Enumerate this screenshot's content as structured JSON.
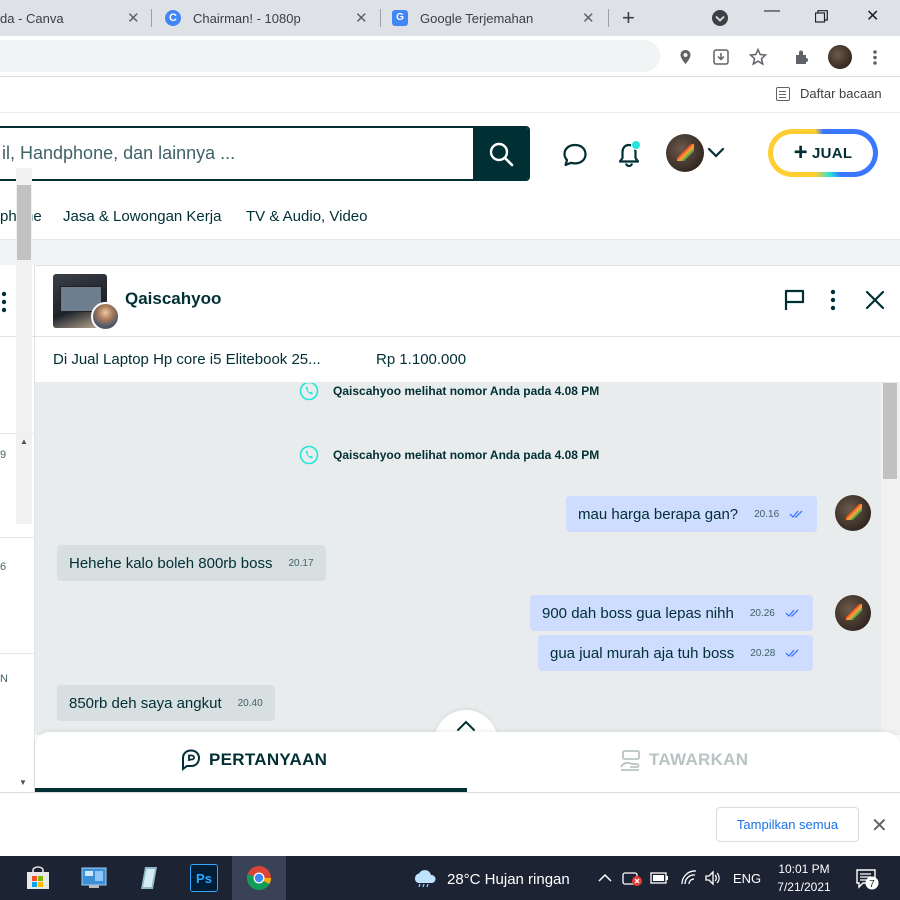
{
  "browser": {
    "tabs": [
      {
        "title": "da - Canva",
        "favicon": "canva-favicon"
      },
      {
        "title": "Chairman! - 1080p",
        "favicon": "chairman-favicon"
      },
      {
        "title": "Google Terjemahan",
        "favicon": "google-translate-favicon"
      }
    ],
    "reading_list": "Daftar bacaan"
  },
  "header": {
    "search_placeholder": "il, Handphone, dan lainnya ...",
    "sell_label": "JUAL",
    "accent_color": "#23e5db",
    "brand_color": "#002f34"
  },
  "categories": [
    "phone",
    "Jasa & Lowongan Kerja",
    "TV & Audio, Video"
  ],
  "left_list": {
    "numbers": [
      "9",
      "6",
      "N"
    ]
  },
  "chat": {
    "contact_name": "Qaiscahyoo",
    "product_title": "Di Jual Laptop Hp core i5 Elitebook 25...",
    "product_price": "Rp 1.100.000",
    "system_messages": [
      "Qaiscahyoo melihat nomor Anda pada 4.08 PM",
      "Qaiscahyoo melihat nomor Anda pada 4.08 PM"
    ],
    "messages": [
      {
        "dir": "out",
        "text": "mau harga berapa gan?",
        "time": "20.16"
      },
      {
        "dir": "in",
        "text": "Hehehe kalo boleh 800rb boss",
        "time": "20.17"
      },
      {
        "dir": "out",
        "text": "900 dah boss gua lepas nihh",
        "time": "20.26"
      },
      {
        "dir": "out",
        "text": "gua jual murah aja tuh boss",
        "time": "20.28"
      },
      {
        "dir": "in",
        "text": "850rb deh saya angkut",
        "time": "20.40"
      }
    ],
    "tabs": {
      "questions": "PERTANYAAN",
      "offer": "TAWARKAN"
    }
  },
  "download_bar": {
    "show_all": "Tampilkan semua"
  },
  "taskbar": {
    "weather": "28°C  Hujan ringan",
    "language": "ENG",
    "time": "10:01 PM",
    "date": "7/21/2021",
    "notification_count": "7"
  }
}
